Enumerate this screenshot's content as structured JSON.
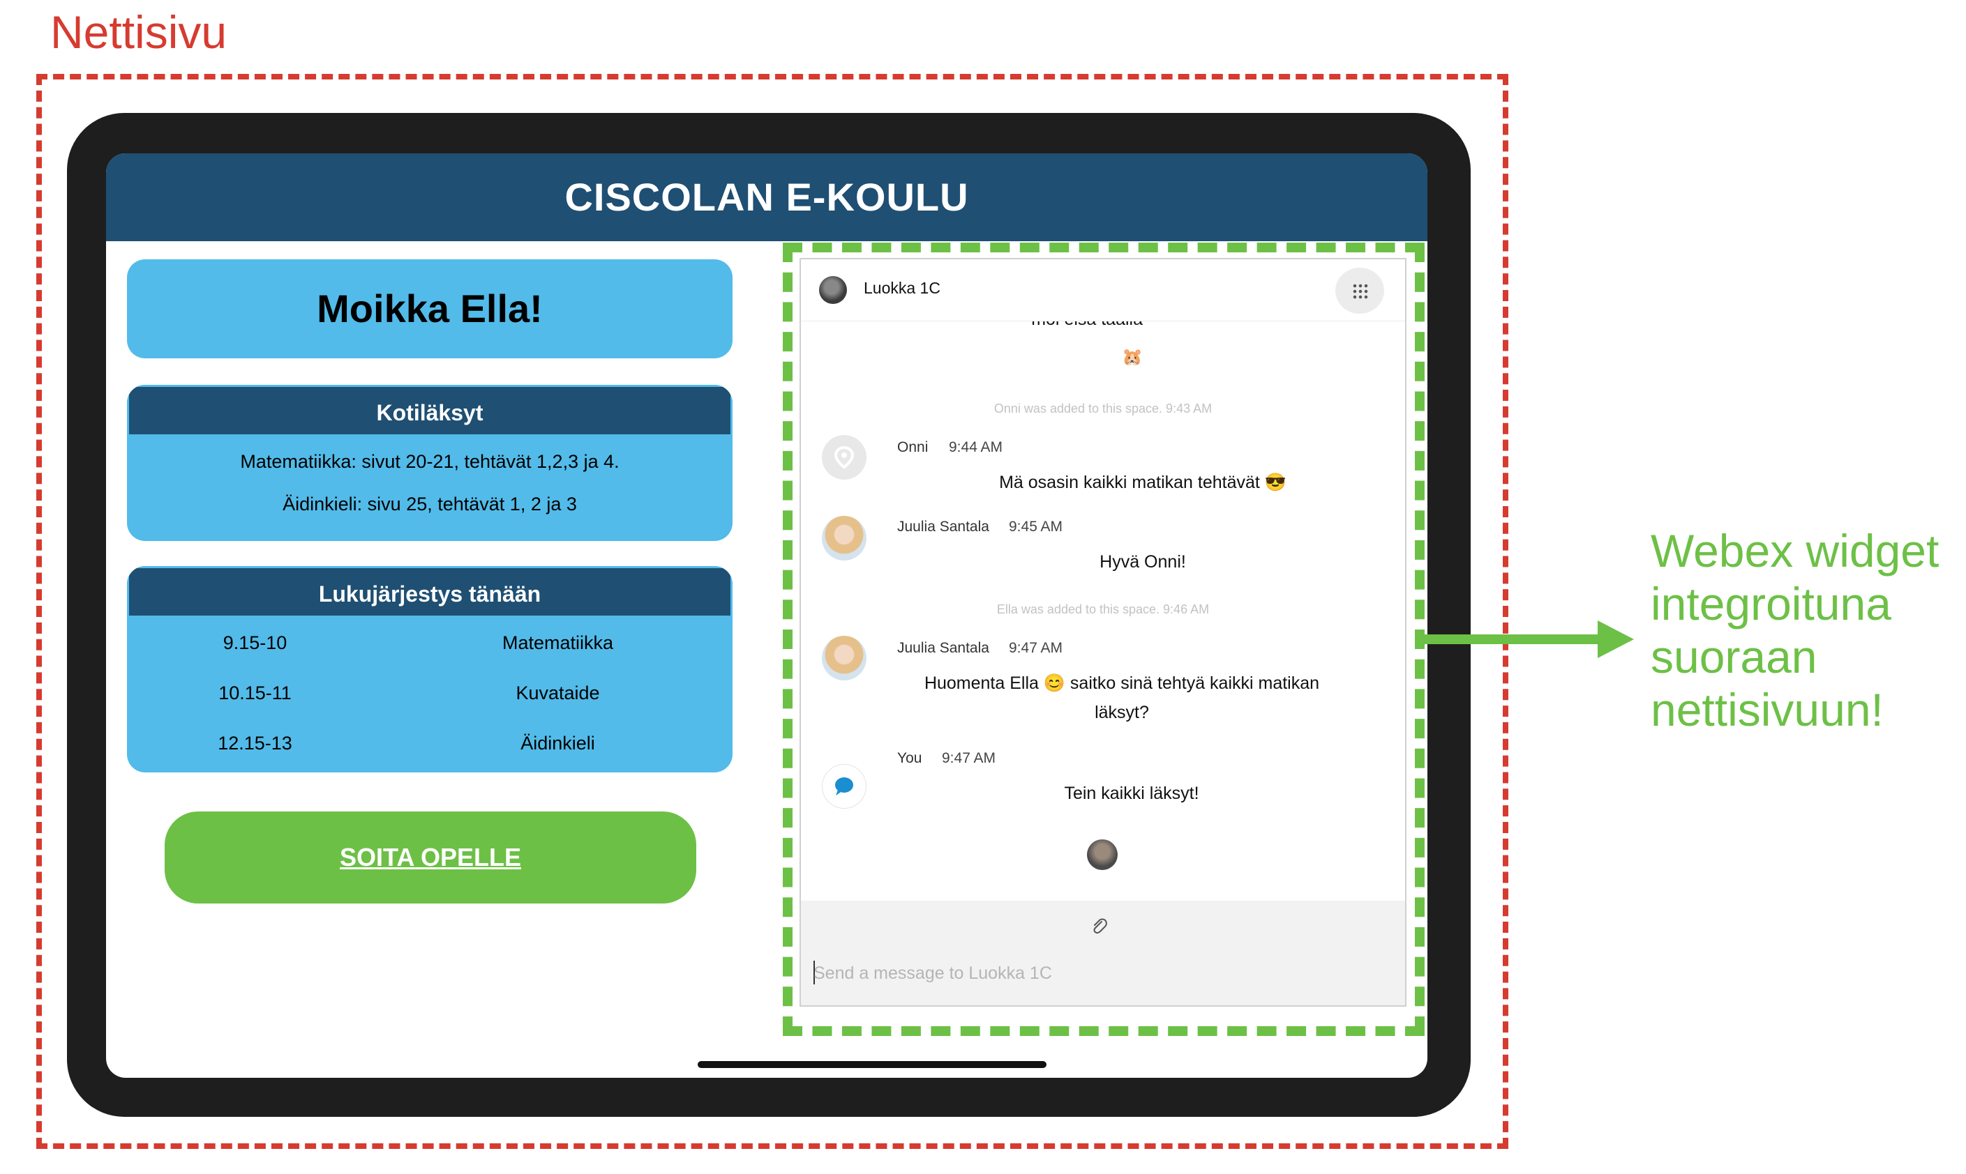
{
  "annotations": {
    "page_label": "Nettisivu",
    "widget_note_lines": [
      "Webex widget",
      "integroituna",
      "suoraan",
      "nettisivuun!"
    ],
    "colors": {
      "page_frame": "#d63b30",
      "widget_frame": "#6dc046"
    }
  },
  "site": {
    "title": "CISCOLAN E-KOULU",
    "greeting": "Moikka Ella!",
    "homework": {
      "heading": "Kotiläksyt",
      "items": [
        "Matematiikka: sivut 20-21, tehtävät 1,2,3 ja 4.",
        "Äidinkieli: sivu 25, tehtävät 1, 2 ja 3"
      ]
    },
    "schedule": {
      "heading": "Lukujärjestys tänään",
      "rows": [
        {
          "time": "9.15-10",
          "subject": "Matematiikka"
        },
        {
          "time": "10.15-11",
          "subject": "Kuvataide"
        },
        {
          "time": "12.15-13",
          "subject": "Äidinkieli"
        }
      ]
    },
    "call_button": "SOITA OPELLE",
    "colors": {
      "header": "#1f4f73",
      "panel": "#52bbe9",
      "button": "#6dc046"
    }
  },
  "widget": {
    "space_title": "Luokka 1C",
    "messages": {
      "m0_text": "moi elsa täällä",
      "m0_emoji": "🐹",
      "sys1": "Onni was added to this space. 9:43 AM",
      "m1_sender": "Onni",
      "m1_time": "9:44 AM",
      "m1_text": "Mä osasin kaikki matikan tehtävät 😎",
      "m2_sender": "Juulia Santala",
      "m2_time": "9:45 AM",
      "m2_text": "Hyvä Onni!",
      "sys2": "Ella was added to this space. 9:46 AM",
      "m3_sender": "Juulia Santala",
      "m3_time": "9:47 AM",
      "m3_text_line1": "Huomenta Ella 😊 saitko sinä tehtyä kaikki matikan",
      "m3_text_line2": "läksyt?",
      "m4_sender": "You",
      "m4_time": "9:47 AM",
      "m4_text": "Tein kaikki läksyt!"
    },
    "compose": {
      "placeholder": "Send a message to Luokka 1C",
      "value": ""
    },
    "icons": [
      "space-avatar-icon",
      "activity-menu-icon",
      "location-pin-icon",
      "chat-bubble-icon",
      "paperclip-icon",
      "read-receipt-icon"
    ]
  }
}
